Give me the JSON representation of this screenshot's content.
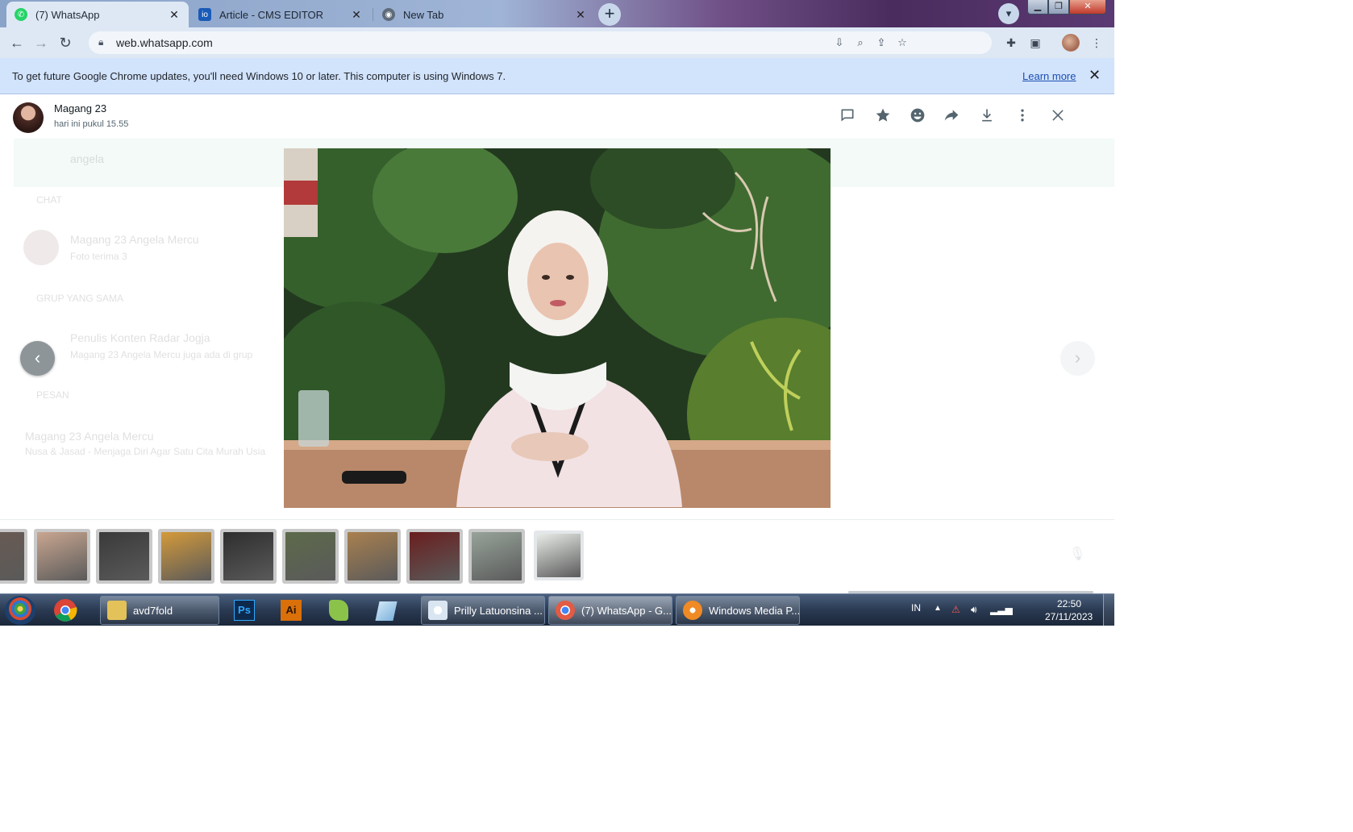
{
  "browser": {
    "tabs": [
      {
        "title": "(7) WhatsApp",
        "favicon": "whatsapp-icon",
        "active": true
      },
      {
        "title": "Article - CMS EDITOR",
        "favicon": "cms-icon",
        "active": false
      },
      {
        "title": "New Tab",
        "favicon": "chrome-icon",
        "active": false
      }
    ],
    "tab_close_glyph": "✕",
    "new_tab_glyph": "+",
    "url": "web.whatsapp.com"
  },
  "infobar": {
    "message": "To get future Google Chrome updates, you'll need Windows 10 or later. This computer is using Windows 7.",
    "link": "Learn more",
    "close_glyph": "✕"
  },
  "viewer": {
    "sender_name": "Magang 23",
    "sender_time": "hari ini pukul 15.55",
    "actions": [
      "reply-icon",
      "star-icon",
      "emoji-icon",
      "forward-icon",
      "download-icon",
      "more-icon",
      "close-icon"
    ],
    "prev_glyph": "‹",
    "next_glyph": "›",
    "thumbnails_count": 10,
    "thumb_colors": [
      "#6b5a52",
      "#c9a690",
      "#3a3a3a",
      "#d49a3a",
      "#2e2e2e",
      "#5d6a4a",
      "#a9804f",
      "#6a1e1e",
      "#97a39a",
      "#e8ece8"
    ],
    "background_text": {
      "search": "angela",
      "section_chats": "CHAT",
      "chat_name": "Magang 23 Angela Mercu",
      "chat_preview": "Foto terima 3",
      "section_groups": "GRUP YANG SAMA",
      "group_name": "Penulis Konten Radar Jogja",
      "group_preview": "Magang 23 Angela Mercu juga ada di grup",
      "section_messages": "PESAN",
      "message_name": "Magang 23 Angela Mercu",
      "message_preview": "Nusa & Jasad - Menjaga Diri Agar Satu Cita Murah Usia"
    }
  },
  "taskbar": {
    "tasks": [
      {
        "label": "avd7fold",
        "icon_color": "#e3c25a"
      },
      {
        "label": "Prilly Latuonsina ...",
        "icon_color": "#d9e6f2"
      },
      {
        "label": "(7) WhatsApp - G...",
        "icon_color": "#e25b44"
      },
      {
        "label": "Windows Media P...",
        "icon_color": "#f08a24"
      }
    ],
    "pinned": [
      "chrome-icon",
      "folder-icon",
      "photoshop-icon",
      "illustrator-icon",
      "android-icon",
      "notepad-icon"
    ],
    "ps_label": "Ps",
    "ai_label": "Ai",
    "lang": "IN",
    "time": "22:50",
    "date": "27/11/2023"
  },
  "colors": {
    "accent_blue": "#1a73e8",
    "whatsapp_green": "#25d366",
    "infobar_bg": "#d2e3fc"
  }
}
